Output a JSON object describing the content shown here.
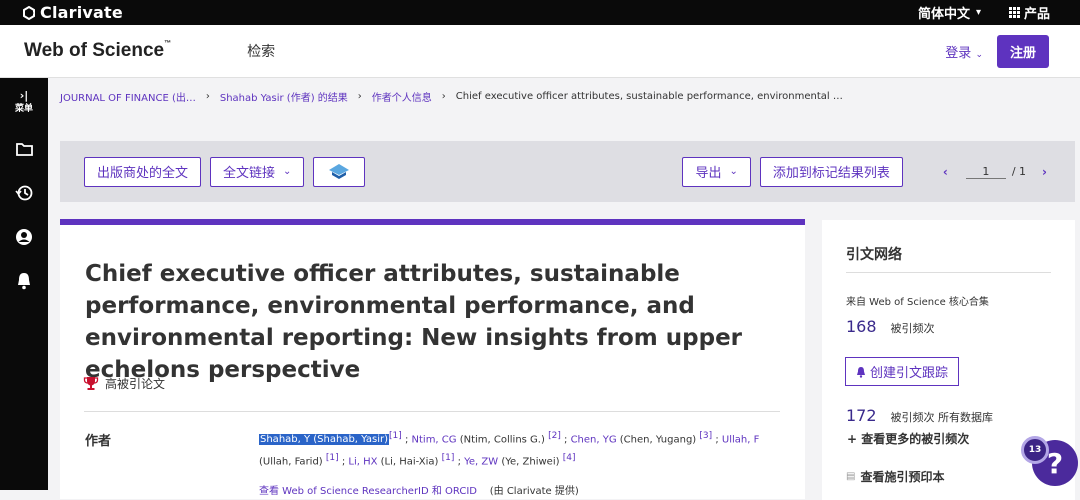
{
  "topbar": {
    "brand": "Clarivate",
    "language": "简体中文",
    "products": "产品"
  },
  "header": {
    "logo": "Web of Science",
    "logo_tm": "™",
    "search": "检索",
    "login": "登录",
    "register": "注册"
  },
  "sidebar": {
    "expand_glyph": "›|",
    "menu_label": "菜单"
  },
  "breadcrumb": {
    "items": [
      "JOURNAL OF FINANCE (出…",
      "Shahab Yasir (作者) 的结果",
      "作者个人信息"
    ],
    "current": "Chief executive officer attributes, sustainable performance, environmental …"
  },
  "toolbar": {
    "full_text": "出版商处的全文",
    "links": "全文链接",
    "export": "导出",
    "add_to_marked": "添加到标记结果列表",
    "page_current": "1",
    "page_total": "/ 1"
  },
  "article": {
    "title": "Chief executive officer attributes, sustainable performance, environmental performance, and environmental reporting: New insights from upper echelons perspective",
    "highly_cited": "高被引论文",
    "authors_label": "作者",
    "authors": [
      {
        "name": "Shahab, Y (Shahab, Yasir)",
        "ref": "[1]"
      },
      {
        "name": "Ntim, CG",
        "full": "(Ntim, Collins G.)",
        "ref": "[2]"
      },
      {
        "name": "Chen, YG",
        "full": "(Chen, Yugang)",
        "ref": "[3]"
      },
      {
        "name": "Ullah, F",
        "full": "(Ullah, Farid)",
        "ref": "[1]"
      },
      {
        "name": "Li, HX",
        "full": "(Li, Hai-Xia)",
        "ref": "[1]"
      },
      {
        "name": "Ye, ZW",
        "full": "(Ye, Zhiwei)",
        "ref": "[4]"
      }
    ],
    "researcher_link": "查看 Web of Science ResearcherID 和 ORCID",
    "provided_by": "(由 Clarivate 提供)"
  },
  "citation_network": {
    "title": "引文网络",
    "source": "来自 Web of Science 核心合集",
    "core_count": "168",
    "core_label": "被引频次",
    "create_alert": "创建引文跟踪",
    "all_count": "172",
    "all_label": "被引频次 所有数据库",
    "more": "+ 查看更多的被引频次",
    "preprint": "查看施引预印本"
  },
  "help": {
    "badge": "13",
    "glyph": "?"
  },
  "colors": {
    "accent": "#5e33bf",
    "dark": "#0a0a0a"
  }
}
